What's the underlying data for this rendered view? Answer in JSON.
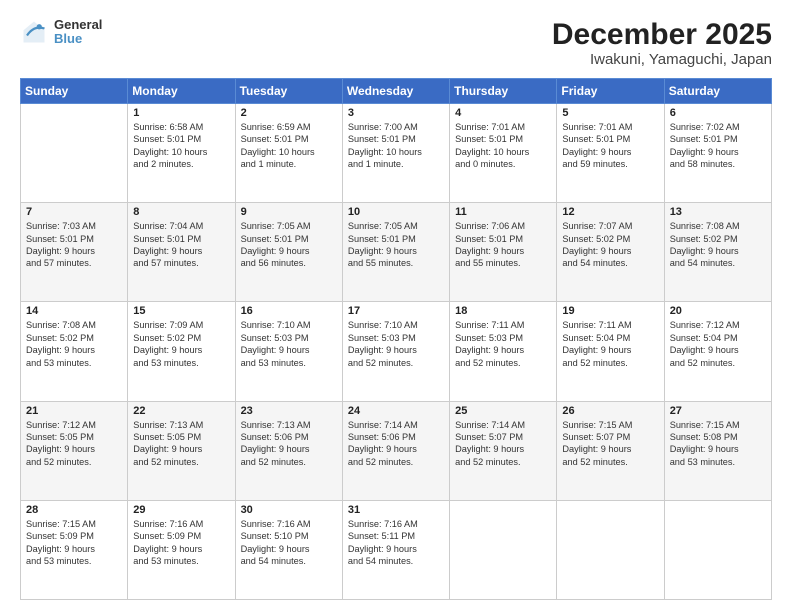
{
  "header": {
    "logo_line1": "General",
    "logo_line2": "Blue",
    "title": "December 2025",
    "subtitle": "Iwakuni, Yamaguchi, Japan"
  },
  "columns": [
    "Sunday",
    "Monday",
    "Tuesday",
    "Wednesday",
    "Thursday",
    "Friday",
    "Saturday"
  ],
  "weeks": [
    [
      {
        "day": "",
        "lines": []
      },
      {
        "day": "1",
        "lines": [
          "Sunrise: 6:58 AM",
          "Sunset: 5:01 PM",
          "Daylight: 10 hours",
          "and 2 minutes."
        ]
      },
      {
        "day": "2",
        "lines": [
          "Sunrise: 6:59 AM",
          "Sunset: 5:01 PM",
          "Daylight: 10 hours",
          "and 1 minute."
        ]
      },
      {
        "day": "3",
        "lines": [
          "Sunrise: 7:00 AM",
          "Sunset: 5:01 PM",
          "Daylight: 10 hours",
          "and 1 minute."
        ]
      },
      {
        "day": "4",
        "lines": [
          "Sunrise: 7:01 AM",
          "Sunset: 5:01 PM",
          "Daylight: 10 hours",
          "and 0 minutes."
        ]
      },
      {
        "day": "5",
        "lines": [
          "Sunrise: 7:01 AM",
          "Sunset: 5:01 PM",
          "Daylight: 9 hours",
          "and 59 minutes."
        ]
      },
      {
        "day": "6",
        "lines": [
          "Sunrise: 7:02 AM",
          "Sunset: 5:01 PM",
          "Daylight: 9 hours",
          "and 58 minutes."
        ]
      }
    ],
    [
      {
        "day": "7",
        "lines": [
          "Sunrise: 7:03 AM",
          "Sunset: 5:01 PM",
          "Daylight: 9 hours",
          "and 57 minutes."
        ]
      },
      {
        "day": "8",
        "lines": [
          "Sunrise: 7:04 AM",
          "Sunset: 5:01 PM",
          "Daylight: 9 hours",
          "and 57 minutes."
        ]
      },
      {
        "day": "9",
        "lines": [
          "Sunrise: 7:05 AM",
          "Sunset: 5:01 PM",
          "Daylight: 9 hours",
          "and 56 minutes."
        ]
      },
      {
        "day": "10",
        "lines": [
          "Sunrise: 7:05 AM",
          "Sunset: 5:01 PM",
          "Daylight: 9 hours",
          "and 55 minutes."
        ]
      },
      {
        "day": "11",
        "lines": [
          "Sunrise: 7:06 AM",
          "Sunset: 5:01 PM",
          "Daylight: 9 hours",
          "and 55 minutes."
        ]
      },
      {
        "day": "12",
        "lines": [
          "Sunrise: 7:07 AM",
          "Sunset: 5:02 PM",
          "Daylight: 9 hours",
          "and 54 minutes."
        ]
      },
      {
        "day": "13",
        "lines": [
          "Sunrise: 7:08 AM",
          "Sunset: 5:02 PM",
          "Daylight: 9 hours",
          "and 54 minutes."
        ]
      }
    ],
    [
      {
        "day": "14",
        "lines": [
          "Sunrise: 7:08 AM",
          "Sunset: 5:02 PM",
          "Daylight: 9 hours",
          "and 53 minutes."
        ]
      },
      {
        "day": "15",
        "lines": [
          "Sunrise: 7:09 AM",
          "Sunset: 5:02 PM",
          "Daylight: 9 hours",
          "and 53 minutes."
        ]
      },
      {
        "day": "16",
        "lines": [
          "Sunrise: 7:10 AM",
          "Sunset: 5:03 PM",
          "Daylight: 9 hours",
          "and 53 minutes."
        ]
      },
      {
        "day": "17",
        "lines": [
          "Sunrise: 7:10 AM",
          "Sunset: 5:03 PM",
          "Daylight: 9 hours",
          "and 52 minutes."
        ]
      },
      {
        "day": "18",
        "lines": [
          "Sunrise: 7:11 AM",
          "Sunset: 5:03 PM",
          "Daylight: 9 hours",
          "and 52 minutes."
        ]
      },
      {
        "day": "19",
        "lines": [
          "Sunrise: 7:11 AM",
          "Sunset: 5:04 PM",
          "Daylight: 9 hours",
          "and 52 minutes."
        ]
      },
      {
        "day": "20",
        "lines": [
          "Sunrise: 7:12 AM",
          "Sunset: 5:04 PM",
          "Daylight: 9 hours",
          "and 52 minutes."
        ]
      }
    ],
    [
      {
        "day": "21",
        "lines": [
          "Sunrise: 7:12 AM",
          "Sunset: 5:05 PM",
          "Daylight: 9 hours",
          "and 52 minutes."
        ]
      },
      {
        "day": "22",
        "lines": [
          "Sunrise: 7:13 AM",
          "Sunset: 5:05 PM",
          "Daylight: 9 hours",
          "and 52 minutes."
        ]
      },
      {
        "day": "23",
        "lines": [
          "Sunrise: 7:13 AM",
          "Sunset: 5:06 PM",
          "Daylight: 9 hours",
          "and 52 minutes."
        ]
      },
      {
        "day": "24",
        "lines": [
          "Sunrise: 7:14 AM",
          "Sunset: 5:06 PM",
          "Daylight: 9 hours",
          "and 52 minutes."
        ]
      },
      {
        "day": "25",
        "lines": [
          "Sunrise: 7:14 AM",
          "Sunset: 5:07 PM",
          "Daylight: 9 hours",
          "and 52 minutes."
        ]
      },
      {
        "day": "26",
        "lines": [
          "Sunrise: 7:15 AM",
          "Sunset: 5:07 PM",
          "Daylight: 9 hours",
          "and 52 minutes."
        ]
      },
      {
        "day": "27",
        "lines": [
          "Sunrise: 7:15 AM",
          "Sunset: 5:08 PM",
          "Daylight: 9 hours",
          "and 53 minutes."
        ]
      }
    ],
    [
      {
        "day": "28",
        "lines": [
          "Sunrise: 7:15 AM",
          "Sunset: 5:09 PM",
          "Daylight: 9 hours",
          "and 53 minutes."
        ]
      },
      {
        "day": "29",
        "lines": [
          "Sunrise: 7:16 AM",
          "Sunset: 5:09 PM",
          "Daylight: 9 hours",
          "and 53 minutes."
        ]
      },
      {
        "day": "30",
        "lines": [
          "Sunrise: 7:16 AM",
          "Sunset: 5:10 PM",
          "Daylight: 9 hours",
          "and 54 minutes."
        ]
      },
      {
        "day": "31",
        "lines": [
          "Sunrise: 7:16 AM",
          "Sunset: 5:11 PM",
          "Daylight: 9 hours",
          "and 54 minutes."
        ]
      },
      {
        "day": "",
        "lines": []
      },
      {
        "day": "",
        "lines": []
      },
      {
        "day": "",
        "lines": []
      }
    ]
  ]
}
